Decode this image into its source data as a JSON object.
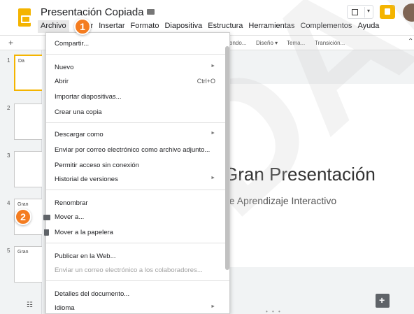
{
  "header": {
    "doc_title": "Presentación Copiada",
    "star_icon": "star-icon",
    "folder_icon": "folder-icon",
    "menubar": [
      "Archivo",
      "Ver",
      "Insertar",
      "Formato",
      "Diapositiva",
      "Estructura",
      "Herramientas",
      "Complementos",
      "Ayuda"
    ]
  },
  "toolbar": {
    "plus": "+",
    "items": [
      "ondo...",
      "Diseño ▾",
      "Tema...",
      "Transición..."
    ]
  },
  "filmstrip": {
    "slide_numbers": [
      "1",
      "2",
      "3",
      "4",
      "5"
    ],
    "thumb_texts": [
      "Da",
      "",
      "",
      "Gran",
      "Gran"
    ]
  },
  "slide": {
    "title": "Gran Presentación",
    "subtitle": "de Aprendizaje Interactivo"
  },
  "watermark": "DAR",
  "menu": {
    "items": [
      {
        "label": "Compartir...",
        "shortcut": "",
        "submenu": false,
        "disabled": false
      },
      {
        "label": "Nuevo",
        "shortcut": "",
        "submenu": true,
        "disabled": false
      },
      {
        "label": "Abrir",
        "shortcut": "Ctrl+O",
        "submenu": false,
        "disabled": false
      },
      {
        "label": "Importar diapositivas...",
        "shortcut": "",
        "submenu": false,
        "disabled": false
      },
      {
        "label": "Crear una copia",
        "shortcut": "",
        "submenu": false,
        "disabled": false
      },
      {
        "label": "Descargar como",
        "shortcut": "",
        "submenu": true,
        "disabled": false
      },
      {
        "label": "Enviar por correo electrónico como archivo adjunto...",
        "shortcut": "",
        "submenu": false,
        "disabled": false
      },
      {
        "label": "Permitir acceso sin conexión",
        "shortcut": "",
        "submenu": false,
        "disabled": false
      },
      {
        "label": "Historial de versiones",
        "shortcut": "",
        "submenu": true,
        "disabled": false
      },
      {
        "label": "Renombrar",
        "shortcut": "",
        "submenu": false,
        "disabled": false
      },
      {
        "label": "Mover a...",
        "shortcut": "",
        "submenu": false,
        "disabled": false
      },
      {
        "label": "Mover a la papelera",
        "shortcut": "",
        "submenu": false,
        "disabled": false
      },
      {
        "label": "Publicar en la Web...",
        "shortcut": "",
        "submenu": false,
        "disabled": false
      },
      {
        "label": "Enviar un correo electrónico a los colaboradores...",
        "shortcut": "",
        "submenu": false,
        "disabled": true
      },
      {
        "label": "Detalles del documento...",
        "shortcut": "",
        "submenu": false,
        "disabled": false
      },
      {
        "label": "Idioma",
        "shortcut": "",
        "submenu": true,
        "disabled": false
      }
    ],
    "submenu_arrow": "►"
  },
  "callouts": [
    "1",
    "2"
  ],
  "colors": {
    "accent": "#f4b400",
    "callout": "#f47c20"
  }
}
